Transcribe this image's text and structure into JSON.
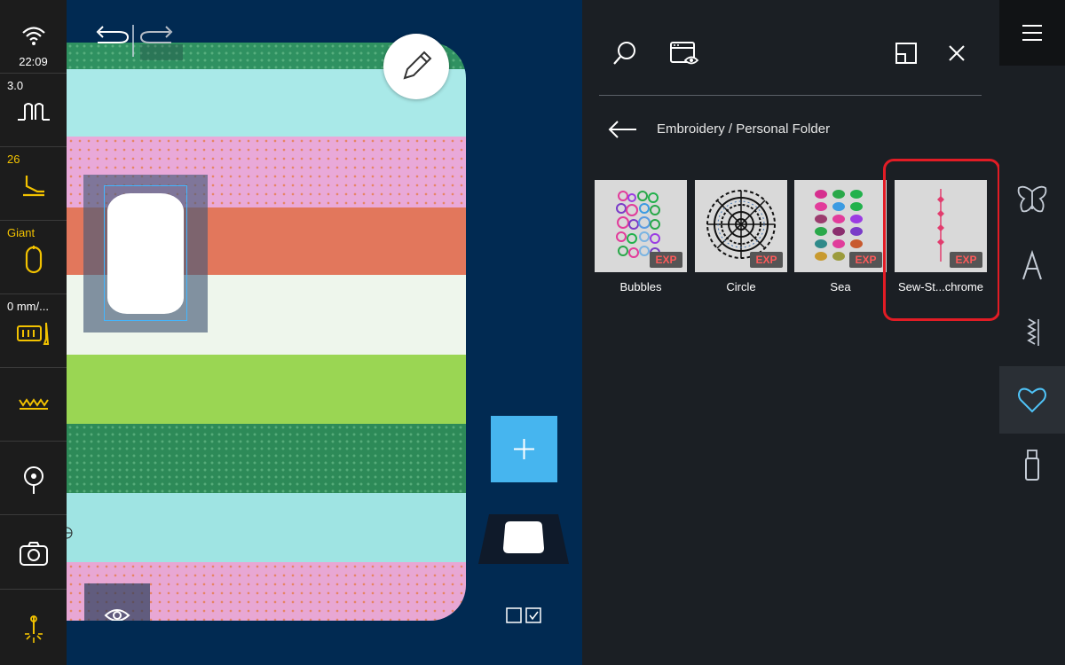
{
  "status": {
    "time": "22:09",
    "stitch_length": "3.0",
    "presser_foot": "26",
    "hoop": "Giant",
    "feed": "0 mm/..."
  },
  "library": {
    "breadcrumb": "Embroidery / Personal Folder",
    "items": [
      {
        "name": "Bubbles",
        "badge": "EXP"
      },
      {
        "name": "Circle",
        "badge": "EXP"
      },
      {
        "name": "Sea",
        "badge": "EXP"
      },
      {
        "name": "Sew-St...chrome",
        "badge": "EXP"
      }
    ]
  },
  "colors": {
    "accent_blue": "#46b5ef",
    "status_yellow": "#f2c200",
    "highlight_red": "#e21c25",
    "panel_dark": "#1b1f24",
    "background_navy": "#012a52"
  },
  "icons": {
    "left": [
      "wifi-icon",
      "stitch-length-icon",
      "presser-foot-icon",
      "hoop-icon",
      "feed-icon",
      "stitch-pattern-icon",
      "needle-position-icon",
      "camera-icon",
      "needle-light-icon"
    ],
    "right": [
      "menu-icon",
      "butterfly-icon",
      "alphabet-icon",
      "stitches-icon",
      "heart-icon",
      "usb-icon"
    ]
  }
}
